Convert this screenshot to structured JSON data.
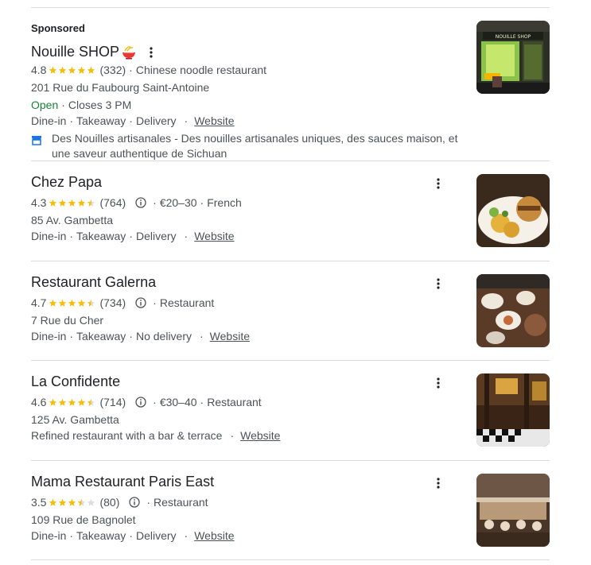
{
  "ad": {
    "sponsored_label": "Sponsored",
    "title": "Nouille SHOP",
    "title_emoji_icon": "noodle-bowl-icon",
    "rating": "4.8",
    "stars": 5,
    "reviews": "(332)",
    "category": "Chinese noodle restaurant",
    "address": "201 Rue du Faubourg Saint-Antoine",
    "open": "Open",
    "hours": "Closes 3 PM",
    "services": [
      "Dine-in",
      "Takeaway",
      "Delivery"
    ],
    "website": "Website",
    "description": "Des Nouilles artisanales - Des nouilles artisanales uniques, des sauces maison, et une saveur authentique de Sichuan",
    "thumb_text": "NOUILLE SHOP"
  },
  "results": [
    {
      "title": "Chez Papa",
      "rating": "4.3",
      "stars": 4.5,
      "reviews": "(764)",
      "price": "€20–30",
      "category": "French",
      "address": "85 Av. Gambetta",
      "services": [
        "Dine-in",
        "Takeaway",
        "Delivery"
      ],
      "website": "Website"
    },
    {
      "title": "Restaurant Galerna",
      "rating": "4.7",
      "stars": 4.5,
      "reviews": "(734)",
      "price": "",
      "category": "Restaurant",
      "address": "7 Rue du Cher",
      "services": [
        "Dine-in",
        "Takeaway",
        "No delivery"
      ],
      "website": "Website"
    },
    {
      "title": "La Confidente",
      "rating": "4.6",
      "stars": 4.5,
      "reviews": "(714)",
      "price": "€30–40",
      "category": "Restaurant",
      "address": "125 Av. Gambetta",
      "services": [
        "Refined restaurant with a bar & terrace"
      ],
      "website": "Website"
    },
    {
      "title": "Mama Restaurant Paris East",
      "rating": "3.5",
      "stars": 3.5,
      "reviews": "(80)",
      "price": "",
      "category": "Restaurant",
      "address": "109 Rue de Bagnolet",
      "services": [
        "Dine-in",
        "Takeaway",
        "Delivery"
      ],
      "website": "Website"
    }
  ],
  "colors": {
    "star": "#fbbc04",
    "star_empty": "#dadce0",
    "open": "#188038",
    "text": "#4d5156"
  }
}
